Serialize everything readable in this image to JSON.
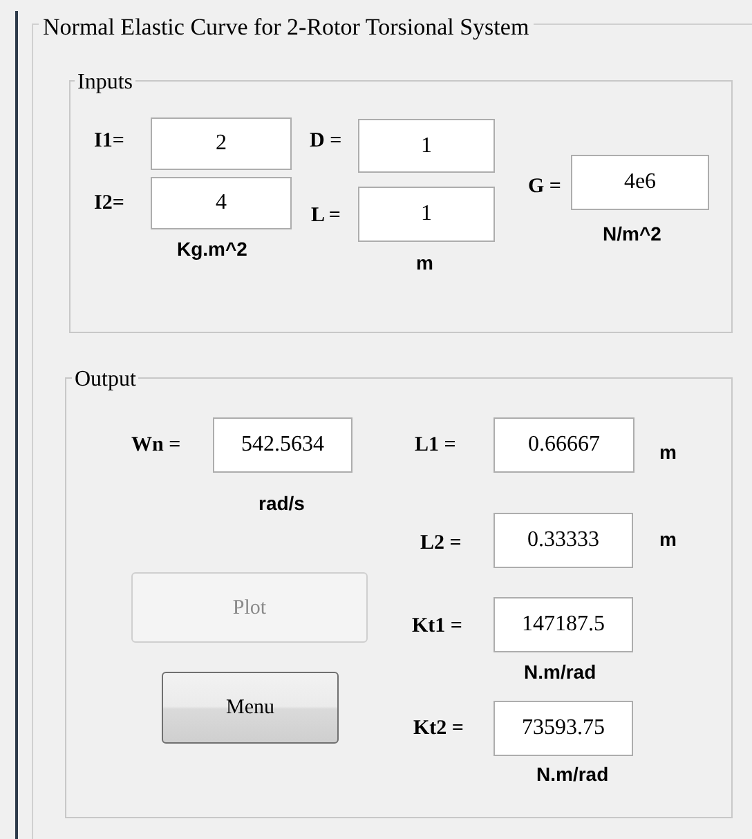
{
  "panel": {
    "title": "Normal Elastic Curve for 2-Rotor Torsional System"
  },
  "inputs": {
    "title": "Inputs",
    "fields": [
      {
        "label": "I1=",
        "value": "2"
      },
      {
        "label": "I2=",
        "value": "4"
      },
      {
        "label": "D =",
        "value": "1"
      },
      {
        "label": "L =",
        "value": "1"
      },
      {
        "label": "G =",
        "value": "4e6"
      }
    ],
    "units": [
      "Kg.m^2",
      "m",
      "N/m^2"
    ]
  },
  "output": {
    "title": "Output",
    "fields": [
      {
        "label": "Wn =",
        "value": "542.5634"
      },
      {
        "label": "L1 =",
        "value": "0.66667"
      },
      {
        "label": "L2 =",
        "value": "0.33333"
      },
      {
        "label": "Kt1 =",
        "value": "147187.5"
      },
      {
        "label": "Kt2 =",
        "value": "73593.75"
      }
    ],
    "units": [
      "rad/s",
      "m",
      "m",
      "N.m/rad",
      "N.m/rad"
    ],
    "buttons": [
      {
        "label": "Plot",
        "disabled": true
      },
      {
        "label": "Menu",
        "disabled": false
      }
    ]
  }
}
